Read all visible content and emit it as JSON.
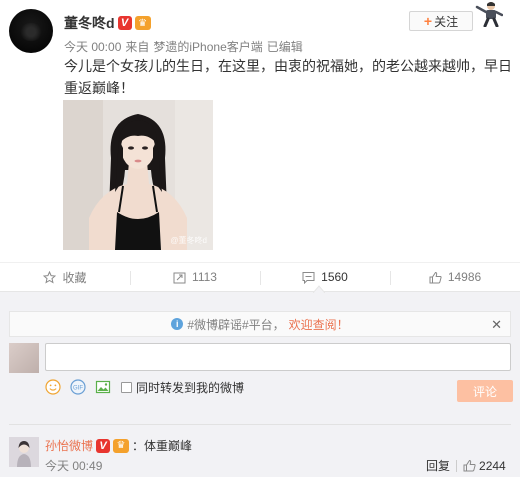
{
  "post": {
    "author": "董冬咚d",
    "time": "今天 00:00",
    "source_prefix": "来自",
    "source": "梦遗的iPhone客户端",
    "edited": "已编辑",
    "follow_label": "关注",
    "text": "今儿是个女孩儿的生日，在这里，由衷的祝福她，的老公越来越帅，早日重返巅峰！",
    "photo_watermark": "@董冬咚d"
  },
  "actions": {
    "favorite": "收藏",
    "forward": "1113",
    "comment": "1560",
    "like": "14986"
  },
  "comments": {
    "notice_parts": [
      "#微博辟谣#平台，",
      "欢迎查阅！"
    ],
    "input_value": "",
    "forward_label": "同时转发到我的微博",
    "submit_label": "评论",
    "items": [
      {
        "user": "孙怡微博",
        "text": "：体重巅峰",
        "time": "今天 00:49",
        "reply_label": "回复",
        "likes": "2244"
      }
    ]
  },
  "colors": {
    "accent": "#eb7350",
    "verified": "#e8352f",
    "comment_button": "#fdc0a2"
  }
}
